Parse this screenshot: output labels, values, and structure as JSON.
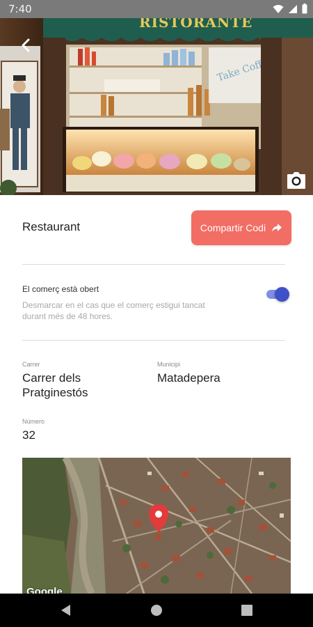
{
  "status_bar": {
    "time": "7:40",
    "icons": [
      "wifi-icon",
      "signal-icon",
      "battery-icon"
    ]
  },
  "hero": {
    "sign_text": "RISTORANTE",
    "back_icon": "chevron-left-icon",
    "camera_icon": "camera-icon"
  },
  "header": {
    "title": "Restaurant",
    "share_label": "Compartir Codi",
    "share_icon": "share-arrow-icon"
  },
  "open_status": {
    "label": "El comerç està obert",
    "hint": "Desmarcar en el cas que el comerç estigui tancat durant més de 48 hores.",
    "enabled": true
  },
  "address": {
    "street_label": "Carrer",
    "street_value": "Carrer dels Pratginestós",
    "municipality_label": "Municipi",
    "municipality_value": "Matadepera",
    "number_label": "Número",
    "number_value": "32"
  },
  "map": {
    "attribution": "Google",
    "marker_icon": "map-pin-icon"
  },
  "nav_bar": {
    "buttons": [
      "back-triangle-icon",
      "home-circle-icon",
      "recents-square-icon"
    ]
  },
  "colors": {
    "accent": "#f26d64",
    "toggle_on": "#3f51c8",
    "status_bar": "#7a7a7a"
  }
}
